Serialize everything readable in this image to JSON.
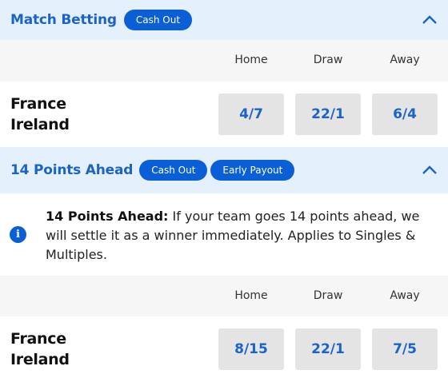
{
  "markets": [
    {
      "title": "Match Betting",
      "badges": [
        "Cash Out"
      ],
      "columns": [
        "Home",
        "Draw",
        "Away"
      ],
      "selection": {
        "team_home": "France",
        "team_away": "Ireland",
        "odds": [
          "4/7",
          "22/1",
          "6/4"
        ]
      }
    },
    {
      "title": "14 Points Ahead",
      "badges": [
        "Cash Out",
        "Early Payout"
      ],
      "info": {
        "heading": "14 Points Ahead:",
        "body": "If your team goes 14 points ahead, we will settle it as a winner immediately. Applies to Singles & Multiples."
      },
      "columns": [
        "Home",
        "Draw",
        "Away"
      ],
      "selection": {
        "team_home": "France",
        "team_away": "Ireland",
        "odds": [
          "8/15",
          "22/1",
          "7/5"
        ]
      }
    }
  ],
  "icons": {
    "collapse": "chevron-up-icon",
    "info": "info-icon"
  },
  "colors": {
    "accent": "#0a5fd6",
    "title": "#1b63c4",
    "header_bg": "#e4f1fd",
    "odds_bg": "#e4e4e4"
  }
}
